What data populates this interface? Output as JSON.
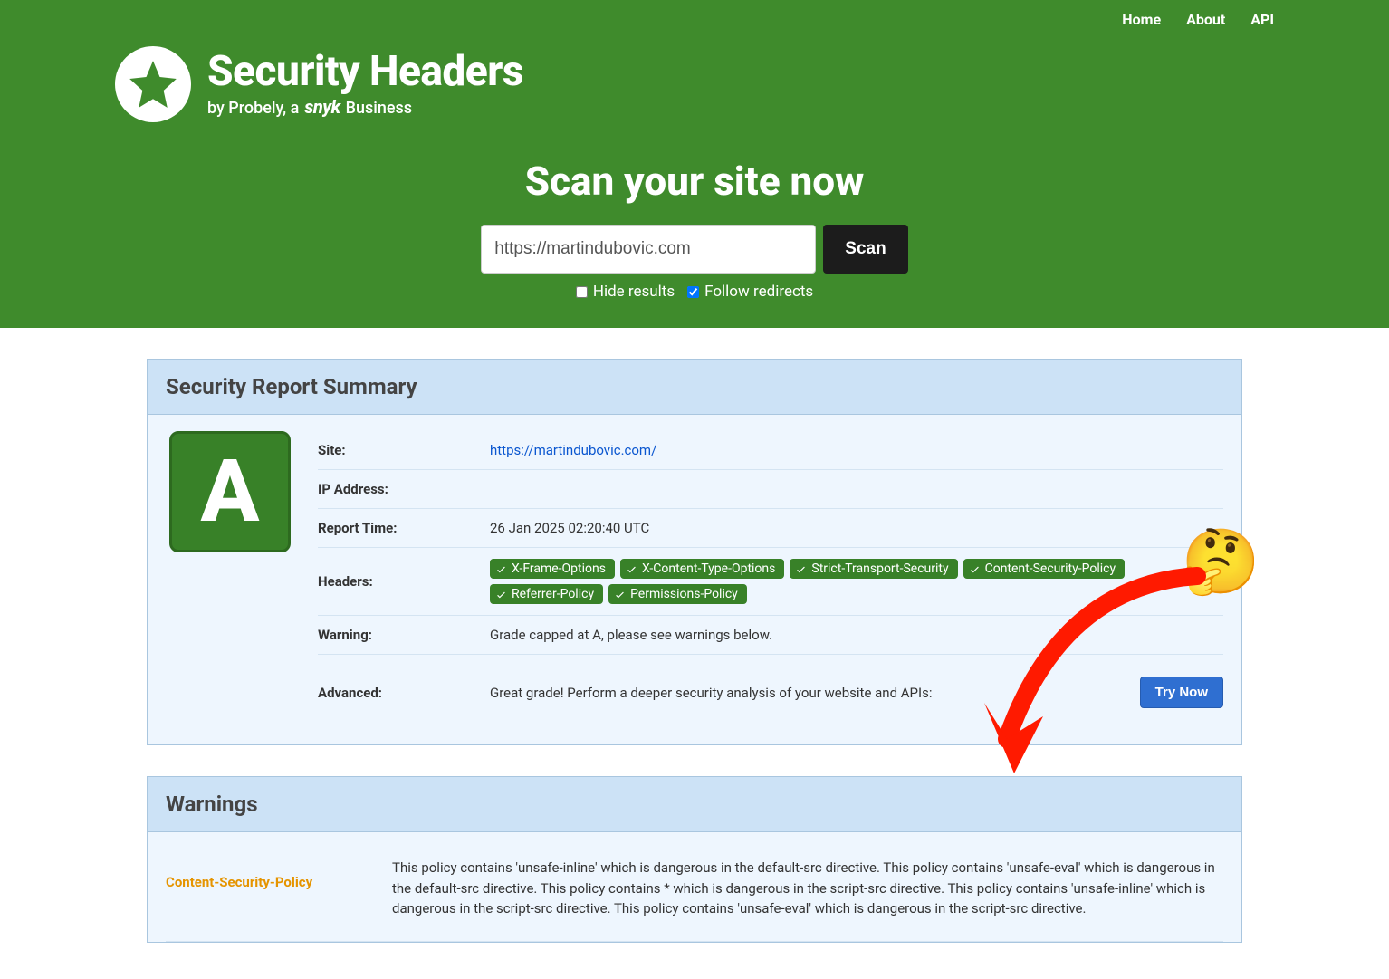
{
  "nav": {
    "home": "Home",
    "about": "About",
    "api": "API"
  },
  "logo": {
    "title": "Security Headers",
    "tagline_prefix": "by Probely, a",
    "tagline_brand": "snyk",
    "tagline_suffix": "Business"
  },
  "scan": {
    "title": "Scan your site now",
    "input_value": "https://martindubovic.com",
    "scan_button": "Scan",
    "hide_results_label": "Hide results",
    "hide_results_checked": false,
    "follow_redirects_label": "Follow redirects",
    "follow_redirects_checked": true
  },
  "summary": {
    "panel_title": "Security Report Summary",
    "grade": "A",
    "rows": {
      "site_label": "Site:",
      "site_value": "https://martindubovic.com/",
      "ip_label": "IP Address:",
      "ip_value": "",
      "report_time_label": "Report Time:",
      "report_time_value": "26 Jan 2025 02:20:40 UTC",
      "headers_label": "Headers:",
      "warning_label": "Warning:",
      "warning_value": "Grade capped at A, please see warnings below.",
      "advanced_label": "Advanced:",
      "advanced_value": "Great grade! Perform a deeper security analysis of your website and APIs:",
      "try_now": "Try Now"
    },
    "header_pills": [
      "X-Frame-Options",
      "X-Content-Type-Options",
      "Strict-Transport-Security",
      "Content-Security-Policy",
      "Referrer-Policy",
      "Permissions-Policy"
    ]
  },
  "warnings": {
    "panel_title": "Warnings",
    "items": [
      {
        "label": "Content-Security-Policy",
        "text": "This policy contains 'unsafe-inline' which is dangerous in the default-src directive. This policy contains 'unsafe-eval' which is dangerous in the default-src directive. This policy contains * which is dangerous in the script-src directive. This policy contains 'unsafe-inline' which is dangerous in the script-src directive. This policy contains 'unsafe-eval' which is dangerous in the script-src directive."
      }
    ]
  },
  "annotation": {
    "emoji": "🤔"
  }
}
